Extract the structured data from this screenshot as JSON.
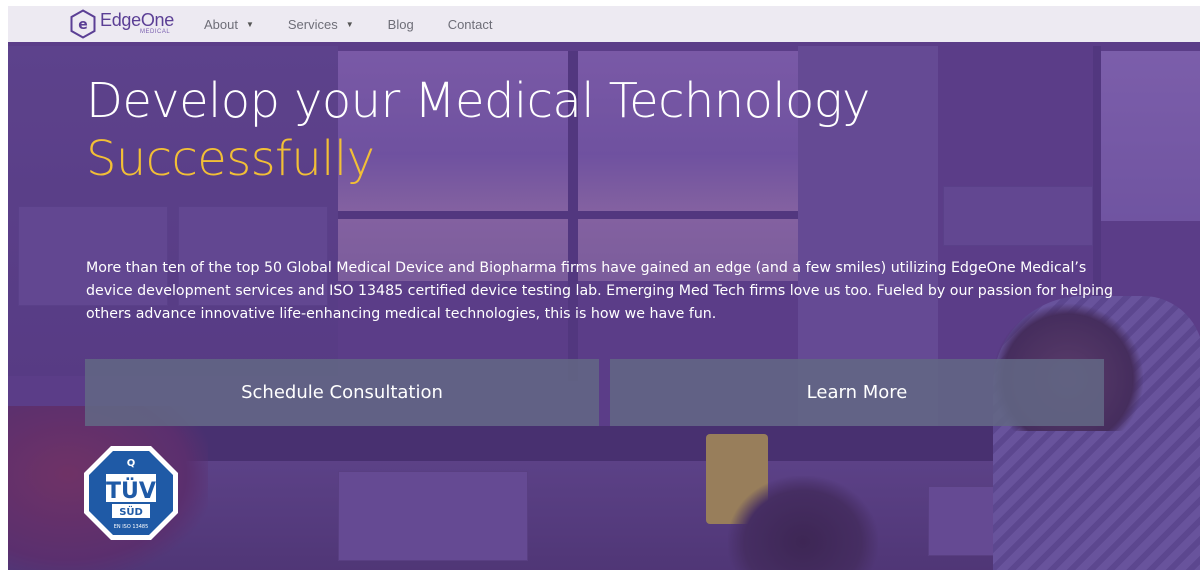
{
  "brand": {
    "name": "EdgeOne",
    "subtitle": "MEDICAL"
  },
  "nav": {
    "items": [
      {
        "label": "About",
        "has_dropdown": true
      },
      {
        "label": "Services",
        "has_dropdown": true
      },
      {
        "label": "Blog",
        "has_dropdown": false
      },
      {
        "label": "Contact",
        "has_dropdown": false
      }
    ]
  },
  "hero": {
    "title_line1": "Develop your Medical Technology",
    "title_line2": "Successfully",
    "body": "More than ten of the top 50 Global Medical Device and Biopharma firms have gained an edge (and a few smiles) utilizing EdgeOne Medical’s device development services and ISO 13485 certified device testing lab.  Emerging Med Tech firms love us too. Fueled by our passion for helping others advance innovative life-enhancing medical technologies, this is how we have fun.",
    "buttons": {
      "schedule": "Schedule Consultation",
      "learn_more": "Learn More"
    }
  },
  "badge": {
    "top_letter": "Q",
    "name": "TÜV",
    "sub": "SÜD",
    "caption": "EN ISO 13485"
  },
  "colors": {
    "accent": "#f2bf36",
    "brand_purple": "#5b3f95",
    "button_bg": "#626684",
    "badge_blue": "#1f5aa6"
  },
  "icons": {
    "logo": "edgeone-logo-icon",
    "dropdown": "chevron-down-icon",
    "certification": "tuv-sud-badge-icon"
  }
}
